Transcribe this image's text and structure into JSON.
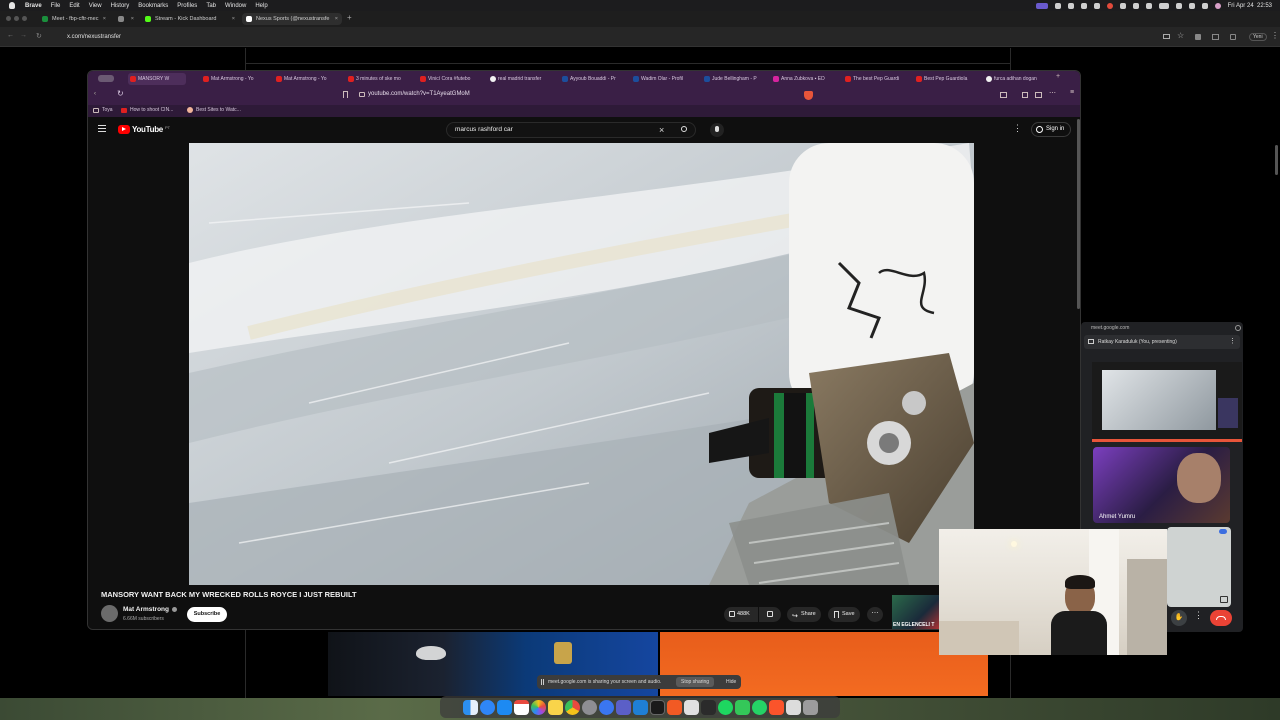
{
  "menubar": {
    "app_name": "Brave",
    "items": [
      "File",
      "Edit",
      "View",
      "History",
      "Bookmarks",
      "Profiles",
      "Tab",
      "Window",
      "Help"
    ],
    "datetime": "Fri Apr 24  22:53"
  },
  "outer_browser": {
    "tabs": [
      {
        "label": "Meet - fbp-cftr-mec",
        "favicon_color": "#1a8f3c"
      },
      {
        "label": "",
        "favicon_color": "#888888"
      },
      {
        "label": "Stream - Kick Dashboard",
        "favicon_color": "#53fc18"
      },
      {
        "label": "Nexus Sports (@nexustransfe",
        "favicon_color": "#ffffff"
      }
    ],
    "url": "x.com/nexustransfer",
    "right_label": "Yeni"
  },
  "inner_browser": {
    "tabs": [
      "MANSORY W",
      "Mat Armstrong - Yo",
      "Mat Armstrong - Yo",
      "3 minutes of ske mo",
      "Vinicí Cora #futebo",
      "real madrid transfer",
      "Ayyoub Bouaddi - Pr",
      "Wadim Olar - Profil",
      "Jude Bellingham - P",
      "Anna Zubkova ▪ ED",
      "The best Pep Guardi",
      "Best Pep Guardiola",
      "furca adihan dogan"
    ],
    "url": "youtube.com/watch?v=T1AyeatGMoM",
    "bookmarks": [
      "Toya",
      "How to shoot CIN...",
      "Best Sites to Watc..."
    ]
  },
  "youtube": {
    "logo": "YouTube",
    "logo_country": "PT",
    "search_value": "marcus rashford car",
    "sign_in": "Sign in",
    "video_title": "MANSORY WANT BACK MY WRECKED ROLLS ROYCE I JUST REBUILT",
    "channel_name": "Mat Armstrong",
    "subscribers": "6.66M subscribers",
    "subscribe": "Subscribe",
    "likes": "488K",
    "share": "Share",
    "save": "Save",
    "thumb_text": "EN EGLENCELI T"
  },
  "meet": {
    "domain": "meet.google.com",
    "presenter": "Ratkay Karaduluk (You, presenting)",
    "participant_name": "Ahmet Yumru"
  },
  "sharebar": {
    "text": "meet.google.com is sharing your screen and audio.",
    "stop_label": "Stop sharing",
    "hide_label": "Hide"
  },
  "colors": {
    "youtube_red": "#ff0000",
    "meet_hangup": "#ea4335",
    "inner_chrome": "#3a1f46",
    "subscribe_bg": "#ffffff"
  }
}
